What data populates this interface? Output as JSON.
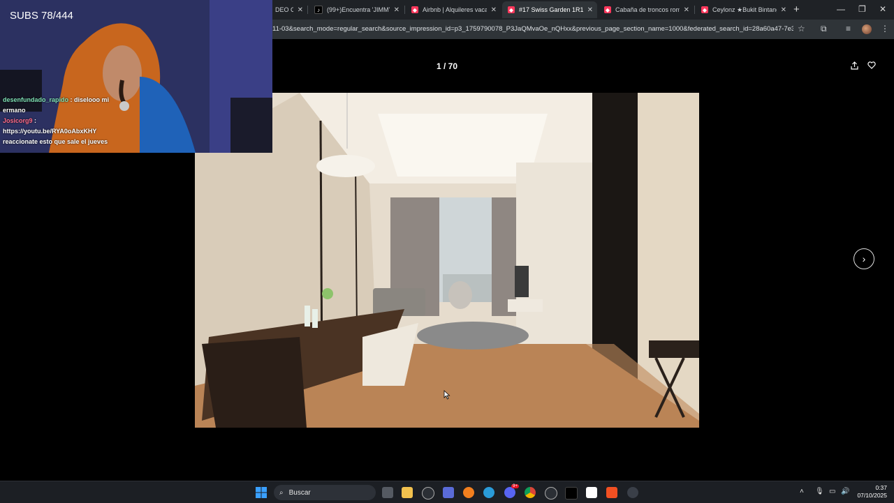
{
  "browser": {
    "tabs": [
      {
        "title": "DEO C",
        "icon": "none"
      },
      {
        "title": "(99+)Encuentra 'JIMMY' e",
        "icon": "tiktok"
      },
      {
        "title": "Airbnb | Alquileres vacac",
        "icon": "airbnb"
      },
      {
        "title": "#17 Swiss Garden 1R1B B",
        "icon": "airbnb"
      },
      {
        "title": "Cabaña de troncos romá",
        "icon": "airbnb"
      },
      {
        "title": "Ceylonz ★Bukit Bintang",
        "icon": "airbnb"
      }
    ],
    "active_tab_index": 3,
    "url": "11-03&search_mode=regular_search&source_impression_id=p3_1759790078_P3JaQMvaOe_nQHxx&previous_page_section_name=1000&federated_search_id=28a60a47-7e3e-462..."
  },
  "gallery": {
    "counter": "1 / 70"
  },
  "stream": {
    "subs": "SUBS 78/444",
    "chat": [
      {
        "user": "desenfundado_rapido",
        "sep": " : ",
        "message": "diselooo mi ermano"
      },
      {
        "user": "Josicorg9",
        "sep": " : ",
        "message": "https://youtu.be/RYA0oAbxKHY reaccionate esto que sale el jueves"
      }
    ]
  },
  "taskbar": {
    "search_placeholder": "Buscar",
    "time": "0:37",
    "date": "07/10/2025",
    "discord_badge": "9+"
  },
  "colors": {
    "airbnb": "#ff385c",
    "chrome_dark": "#1f2226",
    "toolbar": "#2f3438"
  }
}
